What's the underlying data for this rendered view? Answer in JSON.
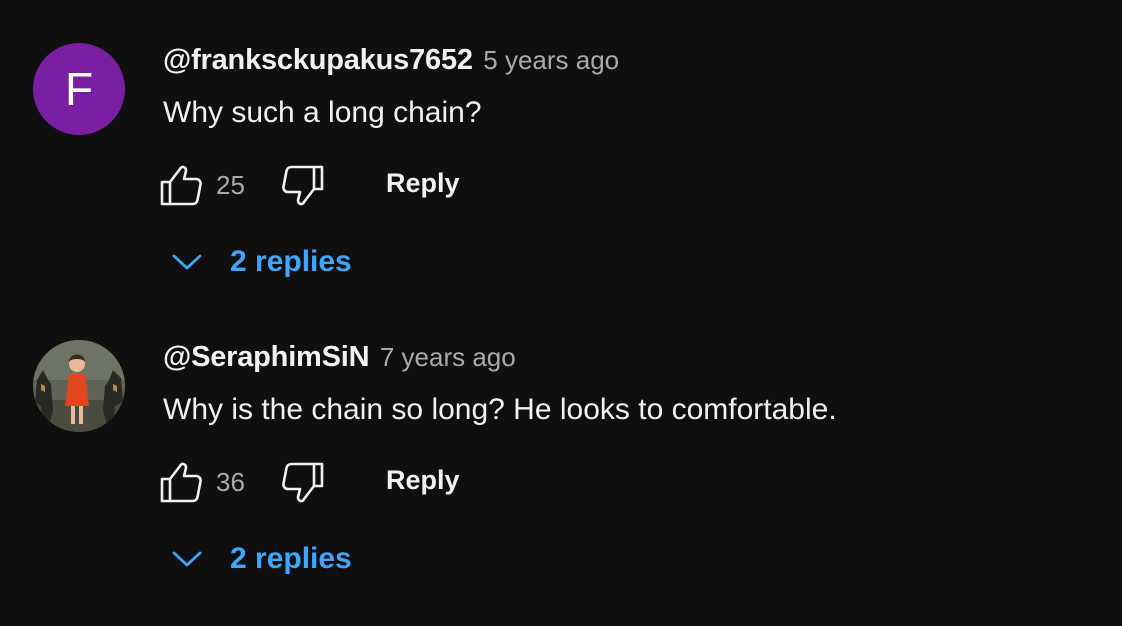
{
  "comments": [
    {
      "author": "@franksckupakus7652",
      "time": "5 years ago",
      "text": "Why such a long chain?",
      "avatar_letter": "F",
      "avatar_color": "#7b1fa2",
      "likes": "25",
      "reply_label": "Reply",
      "replies_label": "2 replies"
    },
    {
      "author": "@SeraphimSiN",
      "time": "7 years ago",
      "text": "Why is the chain so long? He looks to comfortable.",
      "avatar": "photo-avatar",
      "likes": "36",
      "reply_label": "Reply",
      "replies_label": "2 replies"
    }
  ],
  "icons": {
    "like": "thumbs-up-icon",
    "dislike": "thumbs-down-icon",
    "expand": "chevron-down-icon"
  },
  "colors": {
    "background": "#0f0f0f",
    "link_blue": "#3ea6ff",
    "secondary_text": "#aaaaaa"
  }
}
